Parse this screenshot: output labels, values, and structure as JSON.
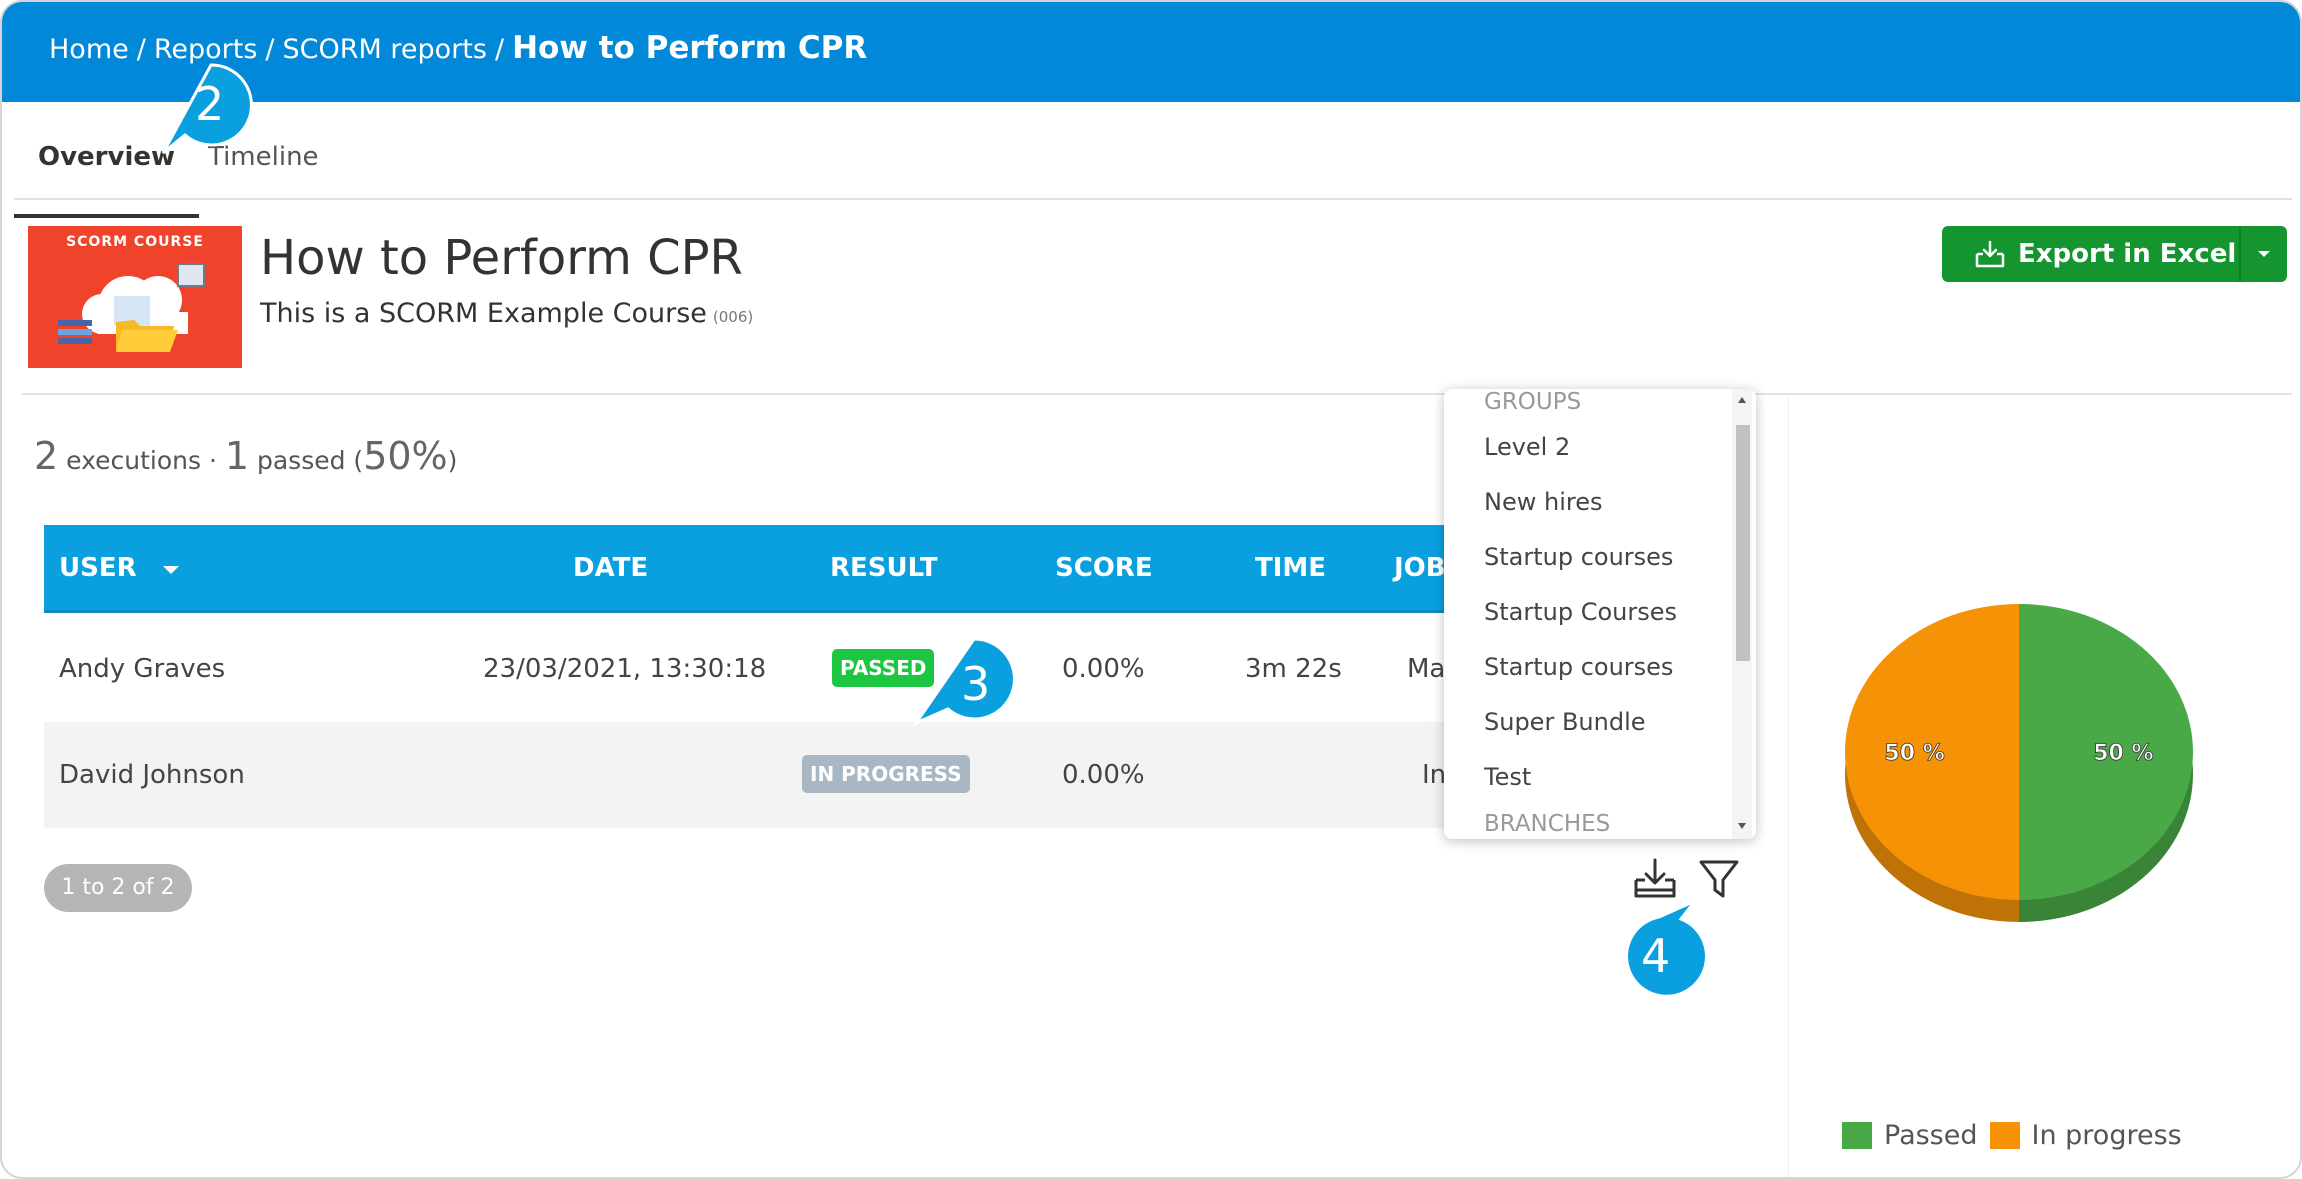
{
  "breadcrumb": {
    "items": [
      "Home",
      "Reports",
      "SCORM reports"
    ],
    "separator": "/",
    "current": "How to Perform CPR"
  },
  "tabs": [
    {
      "label": "Overview",
      "active": true
    },
    {
      "label": "Timeline",
      "active": false
    }
  ],
  "course": {
    "thumbnail_label": "SCORM COURSE",
    "title": "How to Perform CPR",
    "subtitle": "This is a SCORM Example Course",
    "code": "(006)"
  },
  "export": {
    "label": "Export in Excel",
    "icon": "download-tray-icon",
    "caret_icon": "caret-down-icon"
  },
  "summary": {
    "executions_count": "2",
    "executions_label": "executions ·",
    "passed_count": "1",
    "passed_label": "passed (",
    "passed_percent": "50%",
    "close_paren": ")"
  },
  "table": {
    "columns": [
      "USER",
      "DATE",
      "RESULT",
      "SCORE",
      "TIME",
      "JOB"
    ],
    "sort_icon": "caret-down-icon",
    "rows": [
      {
        "user": "Andy Graves",
        "date": "23/03/2021, 13:30:18",
        "result": "PASSED",
        "score": "0.00%",
        "time": "3m 22s",
        "job": "Ma"
      },
      {
        "user": "David Johnson",
        "date": "",
        "result": "IN PROGRESS",
        "score": "0.00%",
        "time": "",
        "job": "In"
      }
    ],
    "pager": "1 to 2 of 2"
  },
  "tools": {
    "download_icon": "download-tray-icon",
    "filter_icon": "filter-funnel-icon"
  },
  "dropdown": {
    "groups_header": "GROUPS",
    "items": [
      "Level 2",
      "New hires",
      "Startup courses",
      "Startup Courses",
      "Startup courses",
      "Super Bundle",
      "Test"
    ],
    "branches_header": "BRANCHES"
  },
  "chart_data": {
    "type": "pie",
    "slices": [
      {
        "label": "Passed",
        "value": 50,
        "display": "50 %",
        "color": "#4aa947"
      },
      {
        "label": "In progress",
        "value": 50,
        "display": "50 %",
        "color": "#f59206"
      }
    ],
    "legend_position": "bottom"
  },
  "callouts": [
    "2",
    "3",
    "4"
  ],
  "colors": {
    "topbar": "#0288d8",
    "table_header": "#0aa0e0",
    "export_button": "#14952f",
    "passed_badge": "#1cc640",
    "progress_badge": "#a9b7c4",
    "callout": "#0aa0e0"
  }
}
